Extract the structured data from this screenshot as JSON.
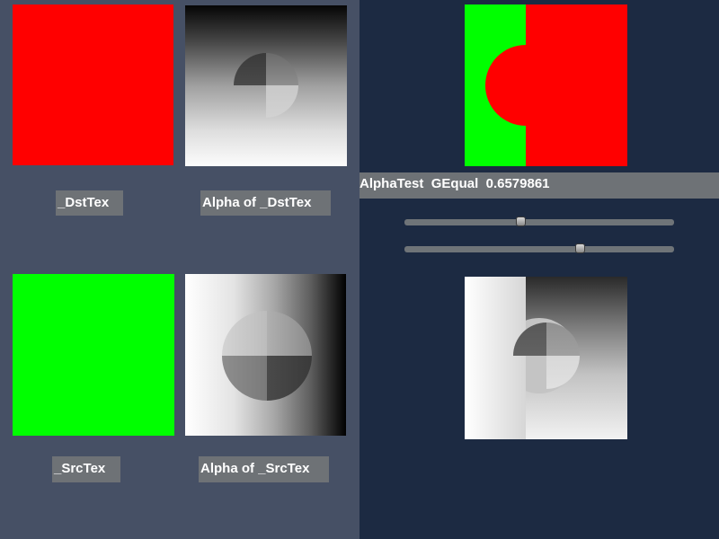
{
  "labels": {
    "dst_tex": "_DstTex",
    "alpha_dst_tex": "Alpha of _DstTex",
    "src_tex": "_SrcTex",
    "alpha_src_tex": "Alpha of _SrcTex"
  },
  "status": {
    "mode": "AlphaTest",
    "compare": "GEqual",
    "threshold": "0.6579861"
  },
  "sliders": [
    {
      "name": "alpha-threshold-slider",
      "value": 0.43
    },
    {
      "name": "second-slider",
      "value": 0.65
    }
  ],
  "colors": {
    "left_panel_bg": "#465065",
    "right_panel_bg": "#1c2a42",
    "label_bg": "#6e7276",
    "red": "#ff0000",
    "green": "#00ff00"
  }
}
